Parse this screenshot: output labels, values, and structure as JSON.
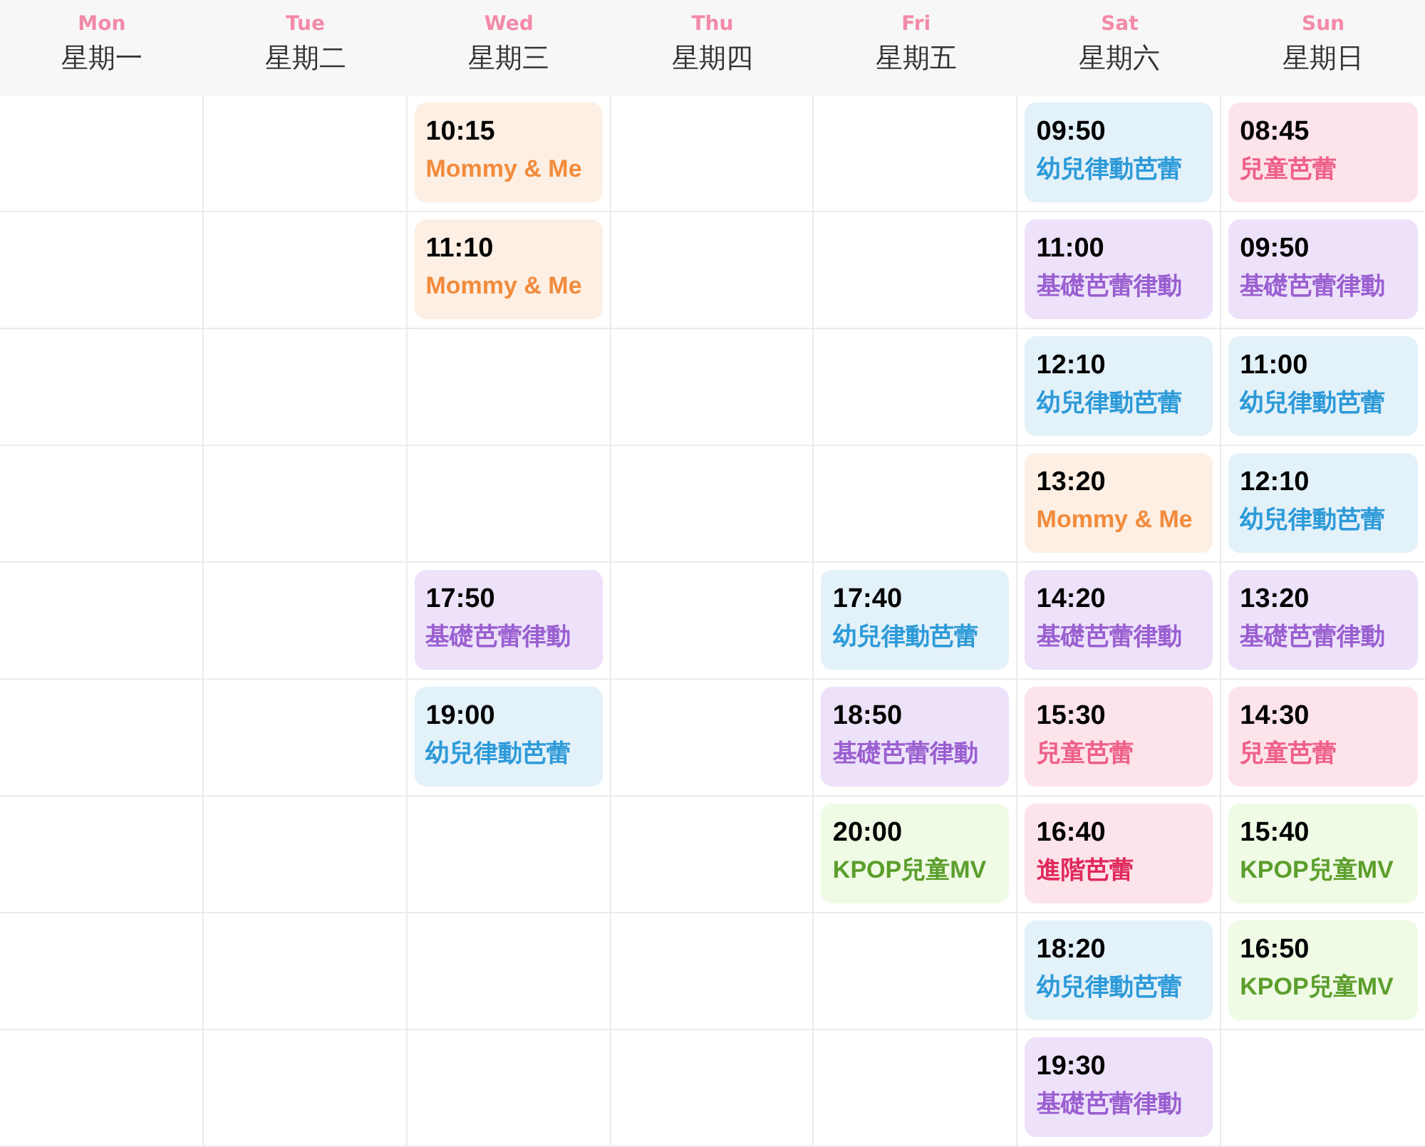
{
  "days": [
    {
      "en": "Mon",
      "zh": "星期一",
      "slots": [
        {
          "kind": "empty"
        },
        {
          "kind": "empty"
        },
        {
          "kind": "empty"
        },
        {
          "kind": "empty"
        },
        {
          "kind": "empty"
        },
        {
          "kind": "empty"
        },
        {
          "kind": "empty"
        },
        {
          "kind": "empty"
        },
        {
          "kind": "empty"
        }
      ]
    },
    {
      "en": "Tue",
      "zh": "星期二",
      "slots": [
        {
          "kind": "empty"
        },
        {
          "kind": "empty"
        },
        {
          "kind": "empty"
        },
        {
          "kind": "empty"
        },
        {
          "kind": "empty"
        },
        {
          "kind": "empty"
        },
        {
          "kind": "empty"
        },
        {
          "kind": "empty"
        },
        {
          "kind": "empty"
        }
      ]
    },
    {
      "en": "Wed",
      "zh": "星期三",
      "slots": [
        {
          "kind": "mommy",
          "time": "10:15",
          "name": "Mommy & Me"
        },
        {
          "kind": "mommy",
          "time": "11:10",
          "name": "Mommy & Me"
        },
        {
          "kind": "empty"
        },
        {
          "kind": "empty"
        },
        {
          "kind": "basic",
          "time": "17:50",
          "name": "基礎芭蕾律動"
        },
        {
          "kind": "toddler",
          "time": "19:00",
          "name": "幼兒律動芭蕾"
        },
        {
          "kind": "empty"
        },
        {
          "kind": "empty"
        },
        {
          "kind": "empty"
        }
      ]
    },
    {
      "en": "Thu",
      "zh": "星期四",
      "slots": [
        {
          "kind": "empty"
        },
        {
          "kind": "empty"
        },
        {
          "kind": "empty"
        },
        {
          "kind": "empty"
        },
        {
          "kind": "empty"
        },
        {
          "kind": "empty"
        },
        {
          "kind": "empty"
        },
        {
          "kind": "empty"
        },
        {
          "kind": "empty"
        }
      ]
    },
    {
      "en": "Fri",
      "zh": "星期五",
      "slots": [
        {
          "kind": "empty"
        },
        {
          "kind": "empty"
        },
        {
          "kind": "empty"
        },
        {
          "kind": "empty"
        },
        {
          "kind": "toddler",
          "time": "17:40",
          "name": "幼兒律動芭蕾"
        },
        {
          "kind": "basic",
          "time": "18:50",
          "name": "基礎芭蕾律動"
        },
        {
          "kind": "kpop",
          "time": "20:00",
          "name": "KPOP兒童MV"
        },
        {
          "kind": "empty"
        },
        {
          "kind": "empty"
        }
      ]
    },
    {
      "en": "Sat",
      "zh": "星期六",
      "slots": [
        {
          "kind": "toddler",
          "time": "09:50",
          "name": "幼兒律動芭蕾"
        },
        {
          "kind": "basic",
          "time": "11:00",
          "name": "基礎芭蕾律動"
        },
        {
          "kind": "toddler",
          "time": "12:10",
          "name": "幼兒律動芭蕾"
        },
        {
          "kind": "mommy",
          "time": "13:20",
          "name": "Mommy & Me"
        },
        {
          "kind": "basic",
          "time": "14:20",
          "name": "基礎芭蕾律動"
        },
        {
          "kind": "kids",
          "time": "15:30",
          "name": "兒童芭蕾"
        },
        {
          "kind": "advanced",
          "time": "16:40",
          "name": "進階芭蕾"
        },
        {
          "kind": "toddler",
          "time": "18:20",
          "name": "幼兒律動芭蕾"
        },
        {
          "kind": "basic",
          "time": "19:30",
          "name": "基礎芭蕾律動"
        }
      ]
    },
    {
      "en": "Sun",
      "zh": "星期日",
      "slots": [
        {
          "kind": "kids",
          "time": "08:45",
          "name": "兒童芭蕾"
        },
        {
          "kind": "basic",
          "time": "09:50",
          "name": "基礎芭蕾律動"
        },
        {
          "kind": "toddler",
          "time": "11:00",
          "name": "幼兒律動芭蕾"
        },
        {
          "kind": "toddler",
          "time": "12:10",
          "name": "幼兒律動芭蕾"
        },
        {
          "kind": "basic",
          "time": "13:20",
          "name": "基礎芭蕾律動"
        },
        {
          "kind": "kids",
          "time": "14:30",
          "name": "兒童芭蕾"
        },
        {
          "kind": "kpop",
          "time": "15:40",
          "name": "KPOP兒童MV"
        },
        {
          "kind": "kpop",
          "time": "16:50",
          "name": "KPOP兒童MV"
        },
        {
          "kind": "empty"
        }
      ]
    }
  ]
}
